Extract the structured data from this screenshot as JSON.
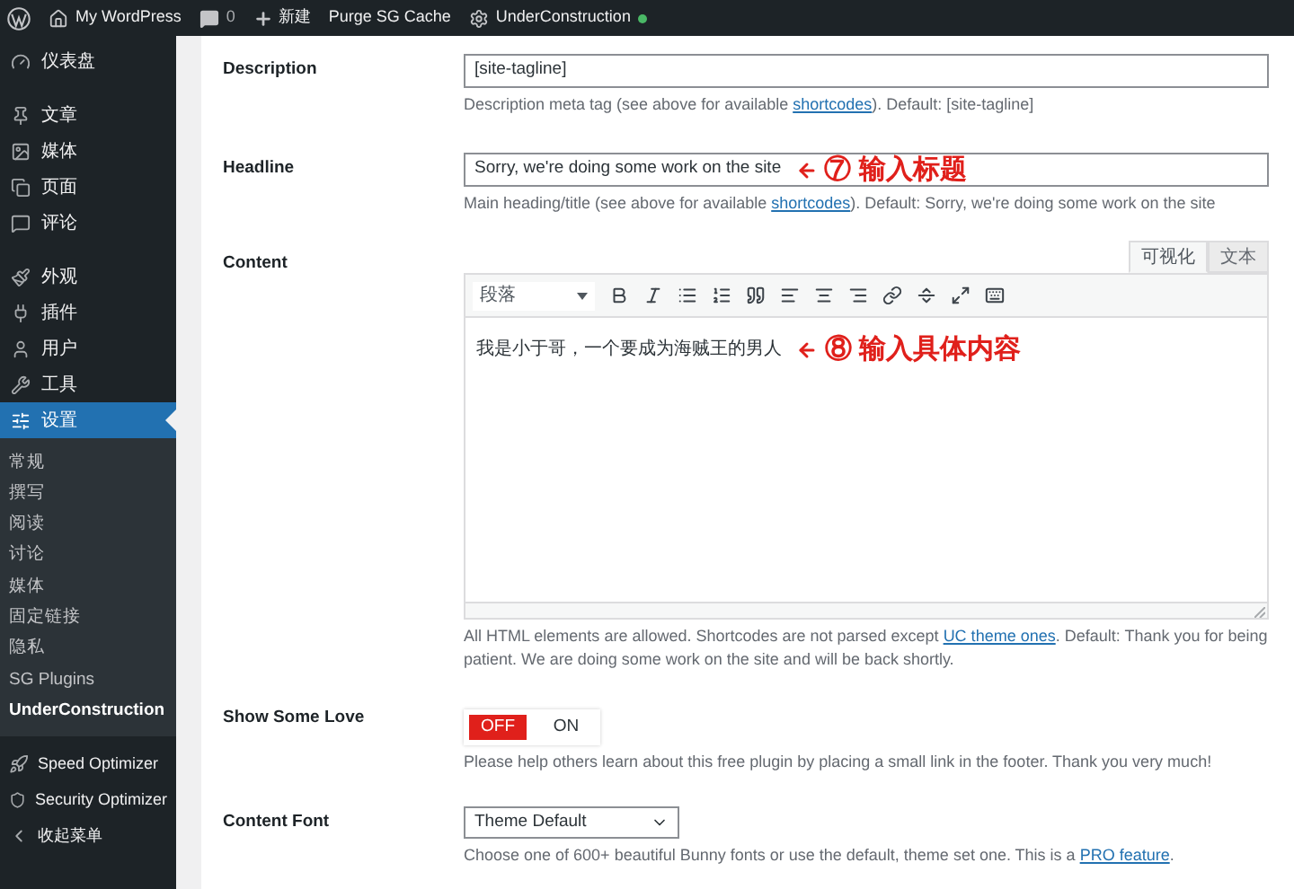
{
  "admin_bar": {
    "site": "My WordPress",
    "comments": "0",
    "new": "新建",
    "purge": "Purge SG Cache",
    "plugin": "UnderConstruction"
  },
  "sidebar": {
    "items": [
      {
        "label": "仪表盘",
        "selected": false,
        "gap_before": false
      },
      {
        "label": "文章",
        "selected": false,
        "gap_before": true
      },
      {
        "label": "媒体",
        "selected": false,
        "gap_before": false
      },
      {
        "label": "页面",
        "selected": false,
        "gap_before": false
      },
      {
        "label": "评论",
        "selected": false,
        "gap_before": false
      },
      {
        "label": "外观",
        "selected": false,
        "gap_before": true
      },
      {
        "label": "插件",
        "selected": false,
        "gap_before": false
      },
      {
        "label": "用户",
        "selected": false,
        "gap_before": false
      },
      {
        "label": "工具",
        "selected": false,
        "gap_before": false
      },
      {
        "label": "设置",
        "selected": true,
        "gap_before": false
      }
    ],
    "submenu": [
      {
        "label": "常规",
        "selected": false
      },
      {
        "label": "撰写",
        "selected": false
      },
      {
        "label": "阅读",
        "selected": false
      },
      {
        "label": "讨论",
        "selected": false
      },
      {
        "label": "媒体",
        "selected": false
      },
      {
        "label": "固定链接",
        "selected": false
      },
      {
        "label": "隐私",
        "selected": false
      },
      {
        "label": "SG Plugins",
        "selected": false
      },
      {
        "label": "UnderConstruction",
        "selected": true
      }
    ],
    "bottom_items": [
      {
        "label": "Speed Optimizer"
      },
      {
        "label": "Security Optimizer"
      },
      {
        "label": "收起菜单"
      }
    ]
  },
  "settings": [
    {
      "kind": "text",
      "label": "Description",
      "value": "[site-tagline]",
      "help": {
        "before": "Description meta tag (see above for available ",
        "link": "shortcodes",
        "after": "). Default: [site-tagline]"
      }
    },
    {
      "kind": "text",
      "label": "Headline",
      "value": "Sorry, we're doing some work on the site",
      "annotation": {
        "number": "⑦",
        "text": "输入标题"
      },
      "help": {
        "before": "Main heading/title (see above for available ",
        "link": "shortcodes",
        "after": "). Default: Sorry, we're doing some work on the site"
      }
    },
    {
      "kind": "editor",
      "label": "Content",
      "tabs": [
        {
          "label": "可视化",
          "selected": true
        },
        {
          "label": "文本",
          "selected": false
        }
      ],
      "format": "段落",
      "value": "我是小于哥，一个要成为海贼王的男人",
      "annotation": {
        "number": "⑧",
        "text": "输入具体内容"
      },
      "help": {
        "before": "All HTML elements are allowed. Shortcodes are not parsed except ",
        "link": "UC theme ones",
        "after": ". Default: Thank you for being patient. We are doing some work on the site and will be back shortly."
      }
    },
    {
      "kind": "toggle",
      "label": "Show Some Love",
      "options": [
        {
          "label": "OFF",
          "selected": true
        },
        {
          "label": "ON",
          "selected": false
        }
      ],
      "help": {
        "before": "Please help others learn about this free plugin by placing a small link in the footer. Thank you very much!"
      }
    },
    {
      "kind": "select",
      "label": "Content Font",
      "value": "Theme Default",
      "help": {
        "before": "Choose one of 600+ beautiful Bunny fonts or use the default, theme set one. This is a ",
        "link": "PRO feature",
        "after": "."
      }
    }
  ]
}
